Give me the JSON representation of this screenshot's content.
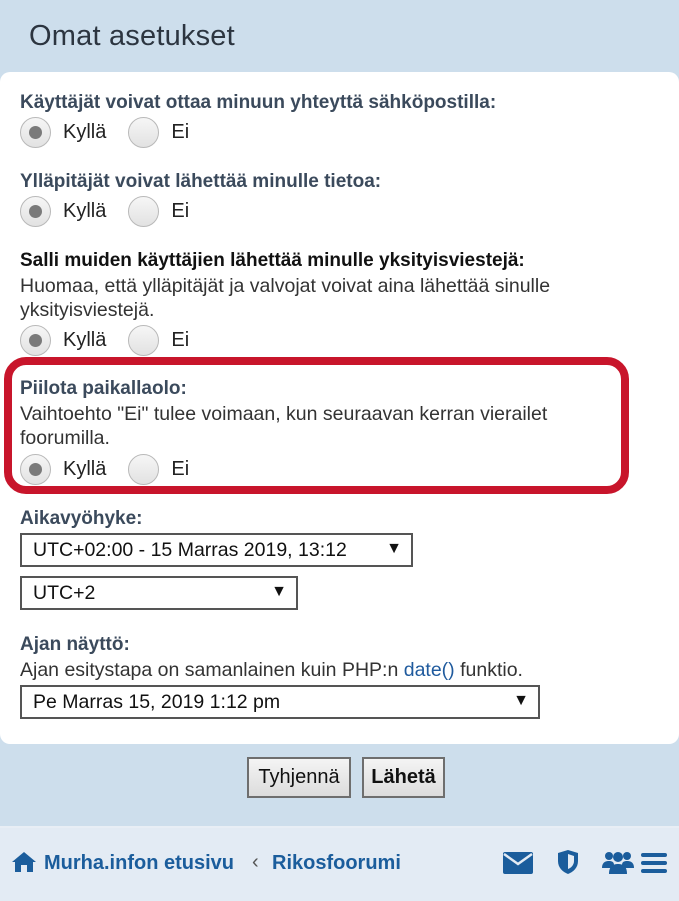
{
  "header": {
    "title": "Omat asetukset"
  },
  "fields": {
    "email": {
      "title": "Käyttäjät voivat ottaa minuun yhteyttä sähköpostilla:",
      "options": [
        "Kyllä",
        "Ei"
      ],
      "selected": "Kyllä"
    },
    "admin_mail": {
      "title": "Ylläpitäjät voivat lähettää minulle tietoa:",
      "options": [
        "Kyllä",
        "Ei"
      ],
      "selected": "Kyllä"
    },
    "pm": {
      "title": "Salli muiden käyttäjien lähettää minulle yksityisviestejä:",
      "desc_line1": "Huomaa, että ylläpitäjät ja valvojat voivat aina lähettää sinulle",
      "desc_line2": "yksityisviestejä.",
      "options": [
        "Kyllä",
        "Ei"
      ],
      "selected": "Kyllä"
    },
    "hide_online": {
      "title": "Piilota paikallaolo:",
      "desc_line1": "Vaihtoehto \"Ei\" tulee voimaan, kun seuraavan kerran vierailet",
      "desc_line2": "foorumilla.",
      "options": [
        "Kyllä",
        "Ei"
      ],
      "selected": "Kyllä"
    },
    "timezone": {
      "title": "Aikavyöhyke:",
      "select_1": "UTC+02:00 - 15 Marras 2019, 13:12",
      "select_2": "UTC+2"
    },
    "date_format": {
      "title": "Ajan näyttö:",
      "desc_before": "Ajan esitystapa on samanlainen kuin PHP:n ",
      "desc_link": "date()",
      "desc_after": " funktio.",
      "select": "Pe Marras 15, 2019 1:12 pm"
    }
  },
  "buttons": {
    "reset": "Tyhjennä",
    "submit": "Lähetä"
  },
  "footer": {
    "breadcrumb_home": "Murha.infon etusivu",
    "separator": "‹",
    "breadcrumb_forum": "Rikosfoorumi"
  },
  "colors": {
    "link": "#1b5d9c",
    "highlight_border": "#c8152b",
    "page_bg": "#cddeec"
  }
}
